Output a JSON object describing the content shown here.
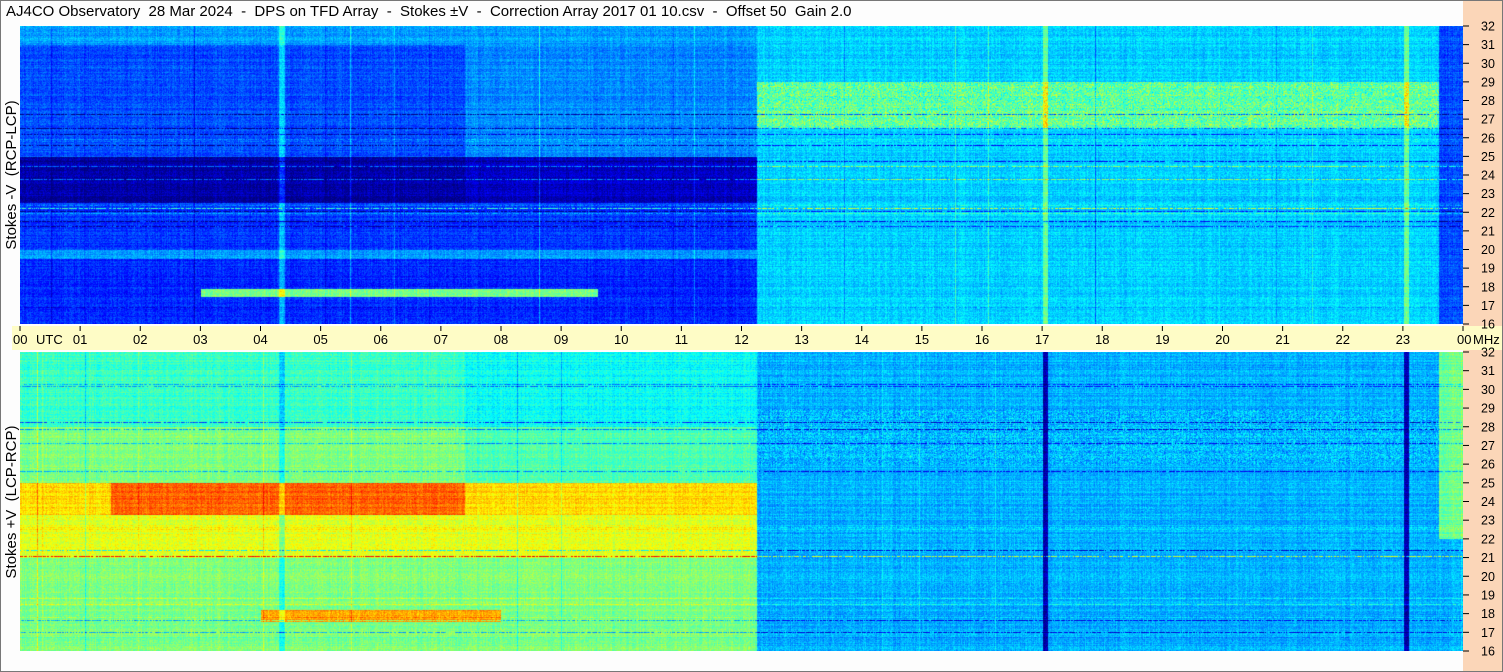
{
  "title": "AJ4CO Observatory  28 Mar 2024  -  DPS on TFD Array  -  Stokes ±V  -  Correction Array 2017 01 10.csv  -  Offset 50  Gain 2.0",
  "chart_data": [
    {
      "type": "heatmap",
      "ylabel": "Stokes -V  (RCP-LCP)",
      "x_ticks": [
        "00",
        "01",
        "02",
        "03",
        "04",
        "05",
        "06",
        "07",
        "08",
        "09",
        "10",
        "11",
        "12",
        "13",
        "14",
        "15",
        "16",
        "17",
        "18",
        "19",
        "20",
        "21",
        "22",
        "23",
        "00"
      ],
      "x_unit": "UTC",
      "y_ticks": [
        16,
        17,
        18,
        19,
        20,
        21,
        22,
        23,
        24,
        25,
        26,
        27,
        28,
        29,
        30,
        31,
        32
      ],
      "y_unit": "MHz",
      "ylim": [
        16,
        32
      ],
      "xlim": [
        0,
        24
      ],
      "colormap": "jet",
      "colors": {
        "low": "#00005a",
        "mid": "#1e6ee6",
        "high": "#fa9a30"
      }
    },
    {
      "type": "heatmap",
      "ylabel": "Stokes +V  (LCP-RCP)",
      "x_ticks": [
        "00",
        "01",
        "02",
        "03",
        "04",
        "05",
        "06",
        "07",
        "08",
        "09",
        "10",
        "11",
        "12",
        "13",
        "14",
        "15",
        "16",
        "17",
        "18",
        "19",
        "20",
        "21",
        "22",
        "23",
        "00"
      ],
      "x_unit": "UTC",
      "y_ticks": [
        16,
        17,
        18,
        19,
        20,
        21,
        22,
        23,
        24,
        25,
        26,
        27,
        28,
        29,
        30,
        31,
        32
      ],
      "y_unit": "MHz",
      "ylim": [
        16,
        32
      ],
      "xlim": [
        0,
        24
      ],
      "colormap": "jet",
      "colors": {
        "low": "#00005a",
        "mid": "#1e6ee6",
        "high": "#fa9a30"
      }
    }
  ],
  "colors": {
    "time_strip": "#fefcc6",
    "freq_strip": "#fbd6b8"
  }
}
